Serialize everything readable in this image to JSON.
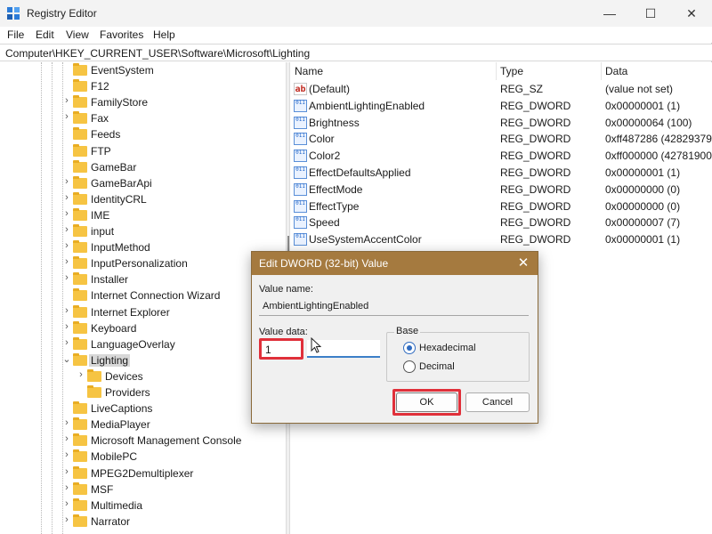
{
  "window": {
    "title": "Registry Editor",
    "controls": {
      "minimize": "—",
      "maximize": "☐",
      "close": "✕"
    }
  },
  "menu": [
    "File",
    "Edit",
    "View",
    "Favorites",
    "Help"
  ],
  "address": "Computer\\HKEY_CURRENT_USER\\Software\\Microsoft\\Lighting",
  "tree": [
    {
      "label": "EventSystem",
      "expander": ""
    },
    {
      "label": "F12",
      "expander": ""
    },
    {
      "label": "FamilyStore",
      "expander": "›"
    },
    {
      "label": "Fax",
      "expander": "›"
    },
    {
      "label": "Feeds",
      "expander": ""
    },
    {
      "label": "FTP",
      "expander": ""
    },
    {
      "label": "GameBar",
      "expander": ""
    },
    {
      "label": "GameBarApi",
      "expander": "›"
    },
    {
      "label": "IdentityCRL",
      "expander": "›"
    },
    {
      "label": "IME",
      "expander": "›"
    },
    {
      "label": "input",
      "expander": "›"
    },
    {
      "label": "InputMethod",
      "expander": "›"
    },
    {
      "label": "InputPersonalization",
      "expander": "›"
    },
    {
      "label": "Installer",
      "expander": "›"
    },
    {
      "label": "Internet Connection Wizard",
      "expander": ""
    },
    {
      "label": "Internet Explorer",
      "expander": "›"
    },
    {
      "label": "Keyboard",
      "expander": "›"
    },
    {
      "label": "LanguageOverlay",
      "expander": "›"
    },
    {
      "label": "Lighting",
      "expander": "⌄",
      "selected": true
    },
    {
      "label": "Devices",
      "expander": "›",
      "child": true
    },
    {
      "label": "Providers",
      "expander": "",
      "child": true
    },
    {
      "label": "LiveCaptions",
      "expander": ""
    },
    {
      "label": "MediaPlayer",
      "expander": "›"
    },
    {
      "label": "Microsoft Management Console",
      "expander": "›"
    },
    {
      "label": "MobilePC",
      "expander": "›"
    },
    {
      "label": "MPEG2Demultiplexer",
      "expander": "›"
    },
    {
      "label": "MSF",
      "expander": "›"
    },
    {
      "label": "Multimedia",
      "expander": "›"
    },
    {
      "label": "Narrator",
      "expander": "›"
    }
  ],
  "list": {
    "headers": {
      "name": "Name",
      "type": "Type",
      "data": "Data"
    },
    "rows": [
      {
        "icon": "string-value-icon",
        "glyph": "ab",
        "name": "(Default)",
        "type": "REG_SZ",
        "data": "(value not set)"
      },
      {
        "icon": "binary-value-icon",
        "glyph": "011",
        "name": "AmbientLightingEnabled",
        "type": "REG_DWORD",
        "data": "0x00000001 (1)"
      },
      {
        "icon": "binary-value-icon",
        "glyph": "011",
        "name": "Brightness",
        "type": "REG_DWORD",
        "data": "0x00000064 (100)"
      },
      {
        "icon": "binary-value-icon",
        "glyph": "011",
        "name": "Color",
        "type": "REG_DWORD",
        "data": "0xff487286 (42829379"
      },
      {
        "icon": "binary-value-icon",
        "glyph": "011",
        "name": "Color2",
        "type": "REG_DWORD",
        "data": "0xff000000 (42781900"
      },
      {
        "icon": "binary-value-icon",
        "glyph": "011",
        "name": "EffectDefaultsApplied",
        "type": "REG_DWORD",
        "data": "0x00000001 (1)"
      },
      {
        "icon": "binary-value-icon",
        "glyph": "011",
        "name": "EffectMode",
        "type": "REG_DWORD",
        "data": "0x00000000 (0)"
      },
      {
        "icon": "binary-value-icon",
        "glyph": "011",
        "name": "EffectType",
        "type": "REG_DWORD",
        "data": "0x00000000 (0)"
      },
      {
        "icon": "binary-value-icon",
        "glyph": "011",
        "name": "Speed",
        "type": "REG_DWORD",
        "data": "0x00000007 (7)"
      },
      {
        "icon": "binary-value-icon",
        "glyph": "011",
        "name": "UseSystemAccentColor",
        "type": "REG_DWORD",
        "data": "0x00000001 (1)"
      }
    ]
  },
  "dialog": {
    "title": "Edit DWORD (32-bit) Value",
    "close": "✕",
    "value_name_label": "Value name:",
    "value_name": "AmbientLightingEnabled",
    "value_data_label": "Value data:",
    "value_data": "1",
    "base_label": "Base",
    "base_options": [
      {
        "label": "Hexadecimal",
        "checked": true
      },
      {
        "label": "Decimal",
        "checked": false
      }
    ],
    "ok": "OK",
    "cancel": "Cancel",
    "accent_color": "#a57a3f",
    "highlight_color": "#e0303a"
  }
}
